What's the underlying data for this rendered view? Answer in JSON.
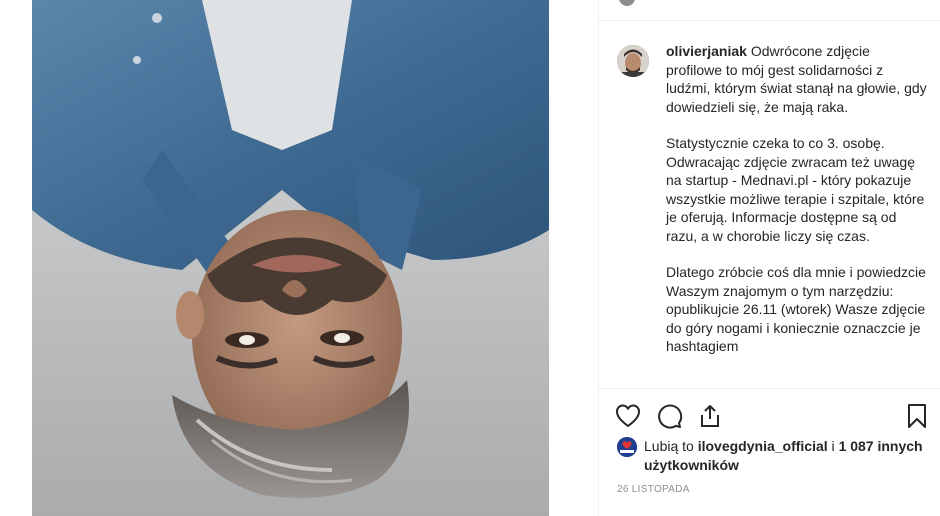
{
  "post": {
    "author": "olivierjaniak",
    "caption_first": "Odwrócone zdjęcie profilowe to mój gest solidarności z ludźmi, którym świat stanął na głowie, gdy dowiedzieli się, że mają raka.",
    "paragraph_2": "Statystycznie czeka to co 3. osobę. Odwracając zdjęcie zwracam też uwagę na startup - Mednavi.pl - który pokazuje wszystkie możliwe terapie i szpitale, które je oferują. Informacje dostępne są od razu, a w chorobie liczy się czas.",
    "paragraph_3": "Dlatego zróbcie coś dla mnie i powiedzcie Waszym znajomym o tym narzędziu: opublikujcie 26.11 (wtorek) Wasze zdjęcie do góry nogami i koniecznie oznaczcie je hashtagiem"
  },
  "actions": {
    "like_icon": "heart-icon",
    "comment_icon": "comment-icon",
    "share_icon": "share-icon",
    "save_icon": "bookmark-icon"
  },
  "likes": {
    "prefix": "Lubią to",
    "first_user": "ilovegdynia_official",
    "connector": "i",
    "others": "1 087 innych użytkowników",
    "avatar_label": "I ❤ GDYNIA"
  },
  "date": "26 LISTOPADA",
  "colors": {
    "text": "#262626",
    "muted": "#8e8e8e",
    "divider": "#efefef",
    "denim": "#4a7296"
  }
}
